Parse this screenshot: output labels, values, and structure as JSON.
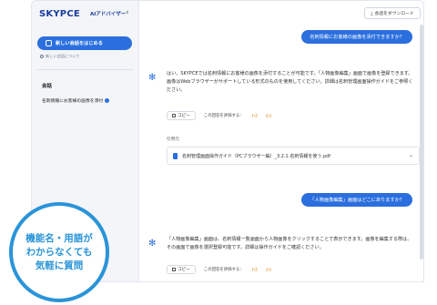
{
  "sidebar": {
    "logo": "SKYPCE",
    "logo_sub": "AIアドバイザー",
    "collapse_icon": "chevron-left-icon",
    "new_chat_label": "新しい会話をはじめる",
    "about_label": "新しい会話について",
    "section_label": "会話",
    "conversation_item": "名刺情報にお客様の画像を添付"
  },
  "toolbar": {
    "download_label": "会話をダウンロード",
    "download_icon": "download-icon"
  },
  "messages": {
    "user_1": "名刺情報にお客様の画像を添付できますか？",
    "ai_1": "はい、SKYPCEでは名刺情報にお客様の画像を添付することが可能です。「人物画像編集」画面で画像を登録できます。画像はWebブラウザーがサポートしている形式のものを使用してください。詳細は名刺管理画面操作ガイドをご参照ください。",
    "user_2": "「人物画像編集」画面はどこにありますか？",
    "ai_2": "「人物画像編集」画面は、名刺情報一覧画面から人物画像をクリックすることで表示できます。画像を編集する際は、その画面で画像を選択登録可能です。詳細は操作ガイドをご確認ください。"
  },
  "feedback": {
    "copy_label": "コピー",
    "rate_label": "この回答を評価する："
  },
  "source": {
    "label": "引用元",
    "title": "名刺管理画面操作ガイド（PCブラウザー編）_3.2.1.名刺情報を使う.pdf"
  },
  "promo": {
    "line1": "機能名・用語が",
    "line2": "わからなくても",
    "line3": "気軽に質問"
  },
  "colors": {
    "accent": "#2b6fde",
    "promo": "#2a94d8",
    "logo": "#1b3d9c"
  }
}
